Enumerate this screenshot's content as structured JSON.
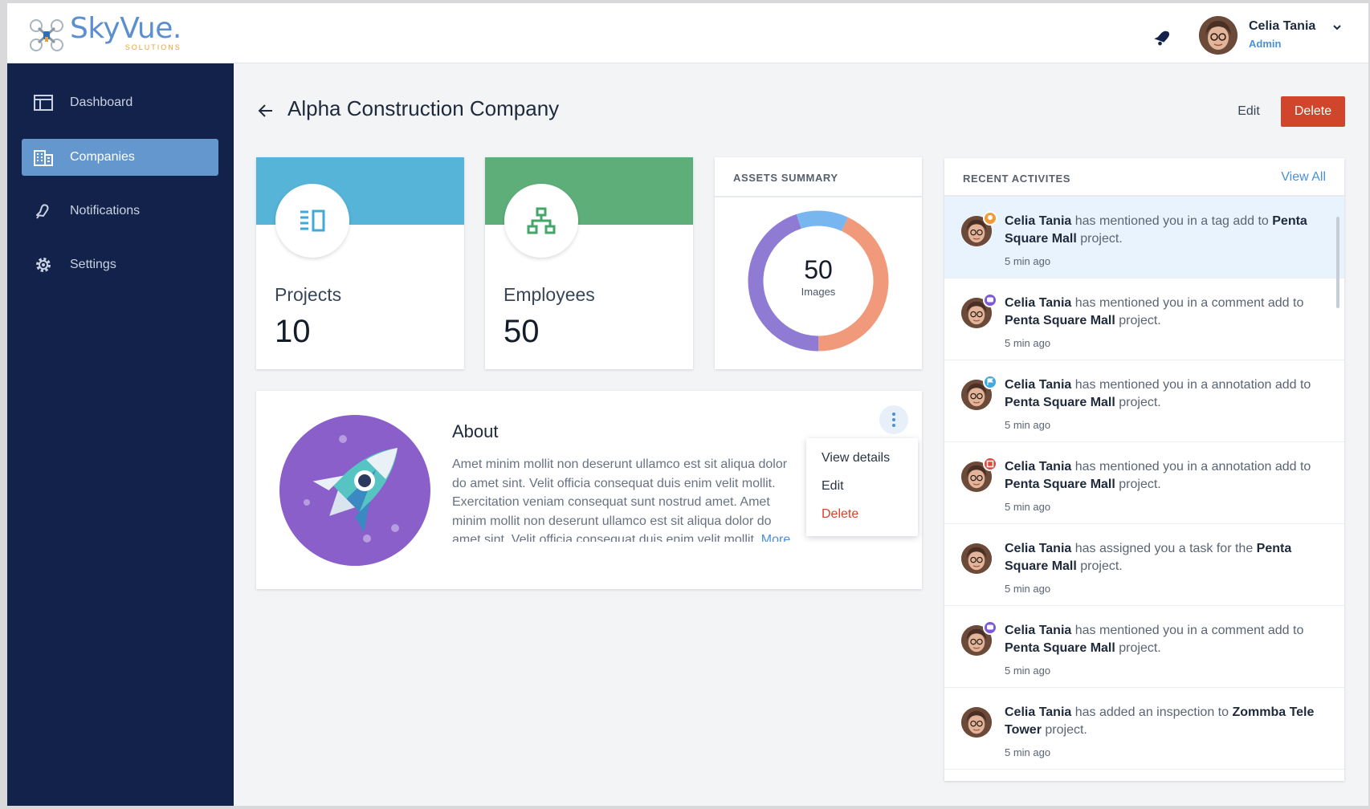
{
  "app": {
    "logo_text": "SkyVue.",
    "logo_sub": "SOLUTIONS"
  },
  "user": {
    "name": "Celia Tania",
    "role": "Admin"
  },
  "sidebar": {
    "items": [
      {
        "label": "Dashboard",
        "icon": "dashboard-icon",
        "active": false
      },
      {
        "label": "Companies",
        "icon": "companies-icon",
        "active": true
      },
      {
        "label": "Notifications",
        "icon": "notifications-icon",
        "active": false
      },
      {
        "label": "Settings",
        "icon": "settings-icon",
        "active": false
      }
    ]
  },
  "page": {
    "title": "Alpha Construction Company",
    "edit_label": "Edit",
    "delete_label": "Delete"
  },
  "stats": {
    "projects": {
      "label": "Projects",
      "value": "10",
      "color": "#55b4d8",
      "icon": "projects-icon"
    },
    "employees": {
      "label": "Employees",
      "value": "50",
      "color": "#5eae7a",
      "icon": "org-chart-icon"
    }
  },
  "assets": {
    "title": "ASSETS SUMMARY",
    "value": "50",
    "unit": "Images",
    "segments": [
      {
        "color": "#f0997b",
        "fraction": 0.43
      },
      {
        "color": "#8f7bd3",
        "fraction": 0.45
      },
      {
        "color": "#78b6ef",
        "fraction": 0.12
      }
    ]
  },
  "about": {
    "title": "About",
    "text": "Amet minim mollit non deserunt ullamco est sit aliqua dolor do amet sint. Velit officia consequat duis enim velit mollit. Exercitation veniam consequat sunt nostrud amet. Amet minim mollit non deserunt ullamco est sit aliqua dolor do amet sint. Velit officia consequat duis enim velit mollit.",
    "more_label": "More",
    "menu": [
      "View details",
      "Edit",
      "Delete"
    ]
  },
  "activities": {
    "title": "RECENT ACTIVITES",
    "view_all": "View All",
    "items": [
      {
        "name": "Celia Tania",
        "text": " has mentioned you in a tag add to ",
        "project": "Penta Square Mall",
        "suffix": " project.",
        "time": "5 min ago",
        "badge": "tag-icon",
        "badge_color": "#f29b3a",
        "highlight": true
      },
      {
        "name": "Celia Tania",
        "text": " has mentioned you in a comment add to ",
        "project": "Penta Square Mall",
        "suffix": " project.",
        "time": "5 min ago",
        "badge": "comment-icon",
        "badge_color": "#7c5ad8",
        "highlight": false
      },
      {
        "name": "Celia Tania",
        "text": " has mentioned you in a annotation add to ",
        "project": "Penta Square Mall",
        "suffix": " project.",
        "time": "5 min ago",
        "badge": "flag-icon",
        "badge_color": "#3fa9e0",
        "highlight": false
      },
      {
        "name": "Celia Tania",
        "text": " has mentioned you in a annotation add to ",
        "project": "Penta Square Mall",
        "suffix": " project.",
        "time": "5 min ago",
        "badge": "crop-icon",
        "badge_color": "#e0473a",
        "highlight": false
      },
      {
        "name": "Celia Tania",
        "text": " has assigned you a task for the ",
        "project": "Penta Square Mall",
        "suffix": " project.",
        "time": "5 min ago",
        "badge": "",
        "badge_color": "",
        "highlight": false
      },
      {
        "name": "Celia Tania",
        "text": " has mentioned you in a comment add to ",
        "project": "Penta Square Mall",
        "suffix": " project.",
        "time": "5 min ago",
        "badge": "comment-icon",
        "badge_color": "#7c5ad8",
        "highlight": false
      },
      {
        "name": "Celia Tania",
        "text": " has added an inspection to ",
        "project": "Zommba Tele Tower",
        "suffix": " project.",
        "time": "5 min ago",
        "badge": "",
        "badge_color": "",
        "highlight": false
      }
    ]
  }
}
